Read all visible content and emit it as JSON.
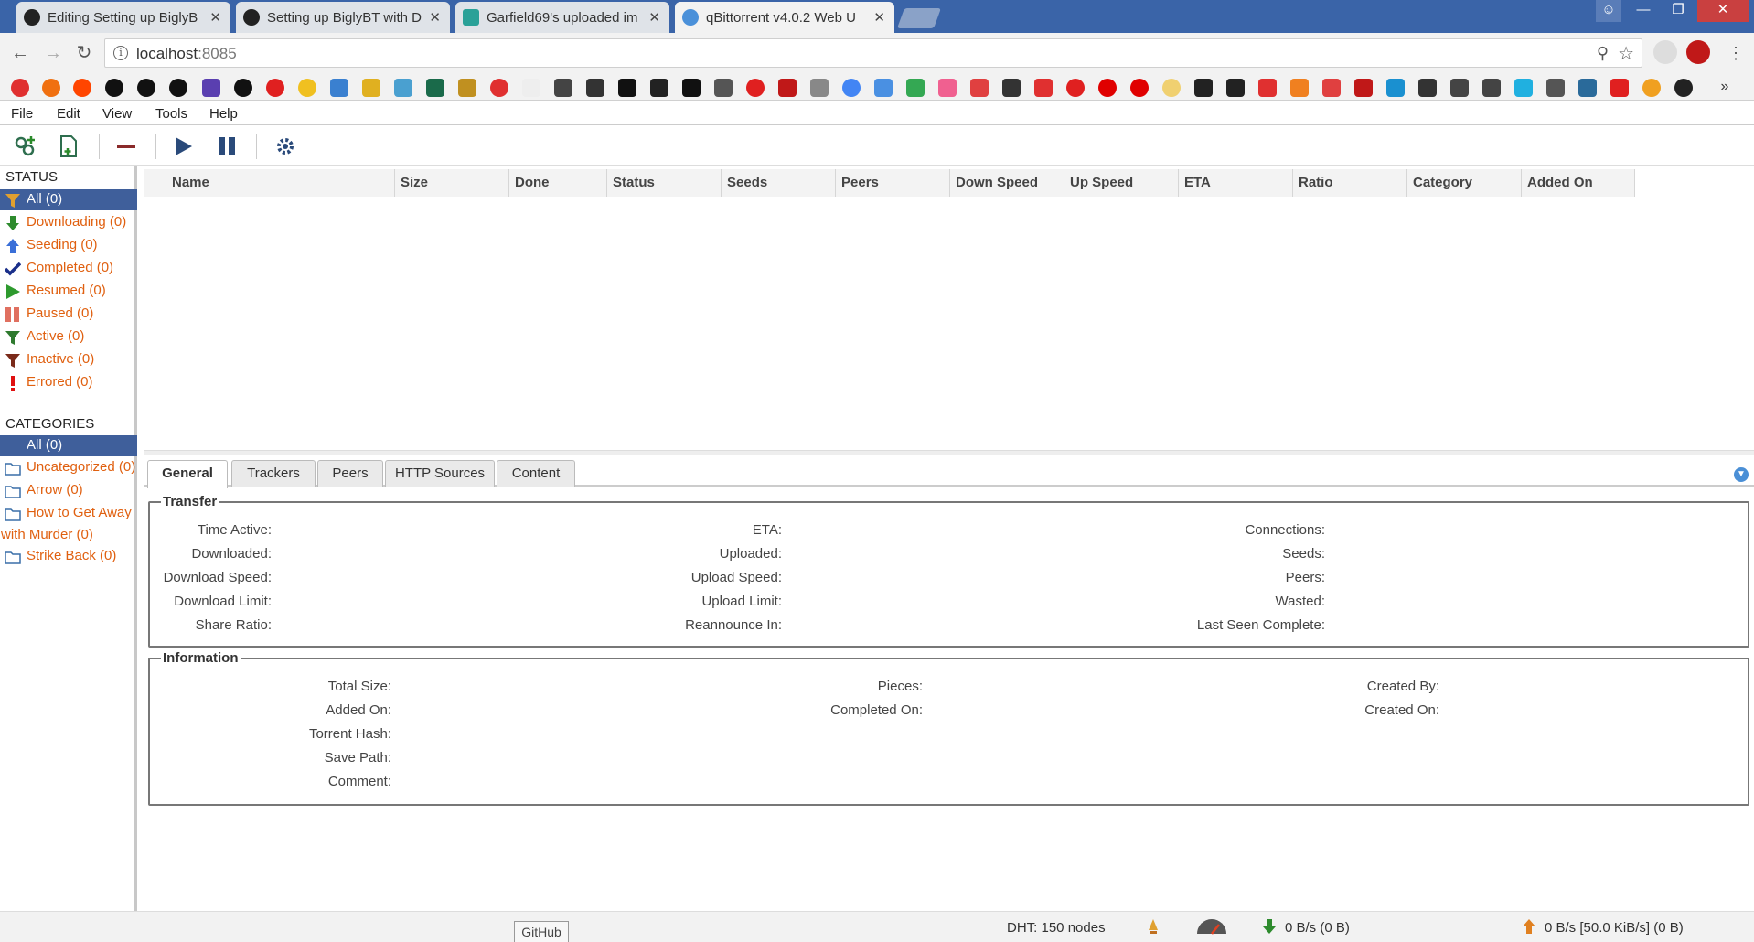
{
  "browser": {
    "tabs": [
      {
        "title": "Editing Setting up BiglyB",
        "icon": "github-icon",
        "active": false
      },
      {
        "title": "Setting up BiglyBT with D",
        "icon": "github-icon",
        "active": false
      },
      {
        "title": "Garfield69's uploaded im",
        "icon": "image-icon",
        "active": false
      },
      {
        "title": "qBittorrent v4.0.2 Web U",
        "icon": "qbittorrent-icon",
        "active": true
      }
    ],
    "close_glyph": "✕",
    "url_host": "localhost",
    "url_port": ":8085"
  },
  "menu": {
    "items": [
      "File",
      "Edit",
      "View",
      "Tools",
      "Help"
    ]
  },
  "toolbar": {
    "buttons": [
      "add-link-icon",
      "add-file-icon",
      "remove-icon",
      "resume-icon",
      "pause-icon",
      "options-icon"
    ]
  },
  "sidebar": {
    "status_header": "STATUS",
    "status_items": [
      {
        "label": "All (0)",
        "icon": "filter-icon",
        "color": "#e0a030",
        "selected": true
      },
      {
        "label": "Downloading (0)",
        "icon": "arrow-down-icon",
        "color": "#2e8b2e",
        "selected": false
      },
      {
        "label": "Seeding (0)",
        "icon": "arrow-up-icon",
        "color": "#3a6fd8",
        "selected": false
      },
      {
        "label": "Completed (0)",
        "icon": "checkmark-icon",
        "color": "#1a2f8a",
        "selected": false
      },
      {
        "label": "Resumed (0)",
        "icon": "play-icon",
        "color": "#2e9a2e",
        "selected": false
      },
      {
        "label": "Paused (0)",
        "icon": "pause-icon",
        "color": "#e07060",
        "selected": false
      },
      {
        "label": "Active (0)",
        "icon": "filter-icon",
        "color": "#2e7a2e",
        "selected": false
      },
      {
        "label": "Inactive (0)",
        "icon": "filter-icon",
        "color": "#7a2a1a",
        "selected": false
      },
      {
        "label": "Errored (0)",
        "icon": "exclamation-icon",
        "color": "#e01010",
        "selected": false
      }
    ],
    "categories_header": "CATEGORIES",
    "category_items": [
      {
        "label": "All (0)",
        "selected": true
      },
      {
        "label": "Uncategorized (0)",
        "selected": false
      },
      {
        "label": "Arrow (0)",
        "selected": false
      },
      {
        "label": "How to Get Away",
        "selected": false
      },
      {
        "label": "with Murder (0)",
        "selected": false
      },
      {
        "label": "Strike Back (0)",
        "selected": false
      }
    ]
  },
  "table": {
    "columns": [
      "Name",
      "Size",
      "Done",
      "Status",
      "Seeds",
      "Peers",
      "Down Speed",
      "Up Speed",
      "ETA",
      "Ratio",
      "Category",
      "Added On"
    ],
    "rows": []
  },
  "properties": {
    "tabs": [
      "General",
      "Trackers",
      "Peers",
      "HTTP Sources",
      "Content"
    ],
    "active_tab": "General",
    "transfer": {
      "legend": "Transfer",
      "col1": [
        "Time Active:",
        "Downloaded:",
        "Download Speed:",
        "Download Limit:",
        "Share Ratio:"
      ],
      "col2": [
        "ETA:",
        "Uploaded:",
        "Upload Speed:",
        "Upload Limit:",
        "Reannounce In:"
      ],
      "col3": [
        "Connections:",
        "Seeds:",
        "Peers:",
        "Wasted:",
        "Last Seen Complete:"
      ]
    },
    "information": {
      "legend": "Information",
      "col1": [
        "Total Size:",
        "Added On:",
        "Torrent Hash:",
        "Save Path:",
        "Comment:"
      ],
      "col2": [
        "Pieces:",
        "Completed On:"
      ],
      "col3": [
        "Created By:",
        "Created On:"
      ]
    }
  },
  "statusbar": {
    "tooltip": "GitHub",
    "dht": "DHT: 150 nodes",
    "download": "0 B/s (0 B)",
    "upload": "0 B/s [50.0 KiB/s] (0 B)"
  },
  "colors": {
    "accent": "#3f5f9b",
    "link": "#e06010",
    "tabbar": "#3a64a8"
  }
}
